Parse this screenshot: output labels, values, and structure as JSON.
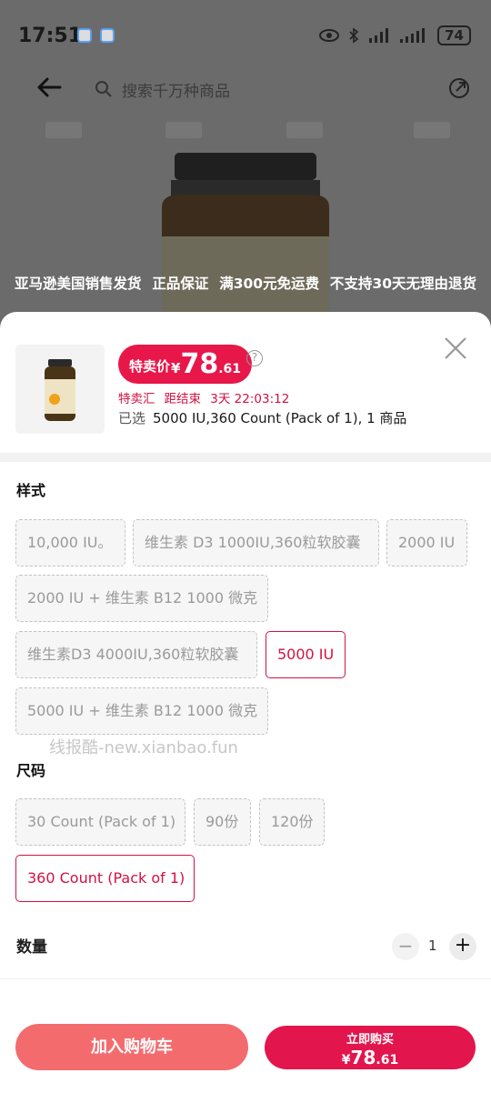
{
  "status_bar": {
    "time": "17:51",
    "battery": "74"
  },
  "top_bar": {
    "search_placeholder": "搜索千万种商品"
  },
  "promo_strip": [
    "亚马逊美国销售发货",
    "正品保证",
    "满300元免运费",
    "不支持30天无理由退货"
  ],
  "product": {
    "price_label": "特卖价",
    "currency": "¥",
    "price_int": "78",
    "price_dec": ".61",
    "sale_name": "特卖汇",
    "countdown_label": "距结束",
    "countdown": "3天 22:03:12",
    "selected_label": "已选",
    "selected_value": "5000 IU,360 Count (Pack of 1), 1 商品"
  },
  "style_section": {
    "title": "样式",
    "options": [
      "10,000 IU。",
      "维生素 D3 1000IU,360粒软胶囊",
      "2000 IU",
      "2000 IU + 维生素 B12 1000 微克",
      "维生素D3 4000IU,360粒软胶囊",
      "5000 IU",
      "5000 IU + 维生素 B12 1000 微克"
    ],
    "selected": "5000 IU"
  },
  "watermark": "线报酷-new.xianbao.fun",
  "size_section": {
    "title": "尺码",
    "options": [
      "30 Count (Pack of 1)",
      "90份",
      "120份",
      "360 Count (Pack of 1)"
    ],
    "selected": "360 Count (Pack of 1)"
  },
  "quantity": {
    "label": "数量",
    "value": "1",
    "minus": "−",
    "plus": "+"
  },
  "actions": {
    "add_to_cart": "加入购物车",
    "buy_now": "立即购买",
    "buy_currency": "¥",
    "buy_price_int": "78",
    "buy_price_dec": ".61"
  },
  "colors": {
    "accent": "#e3154d",
    "cart_button": "#f46b6e",
    "selected_border": "#d21243"
  }
}
